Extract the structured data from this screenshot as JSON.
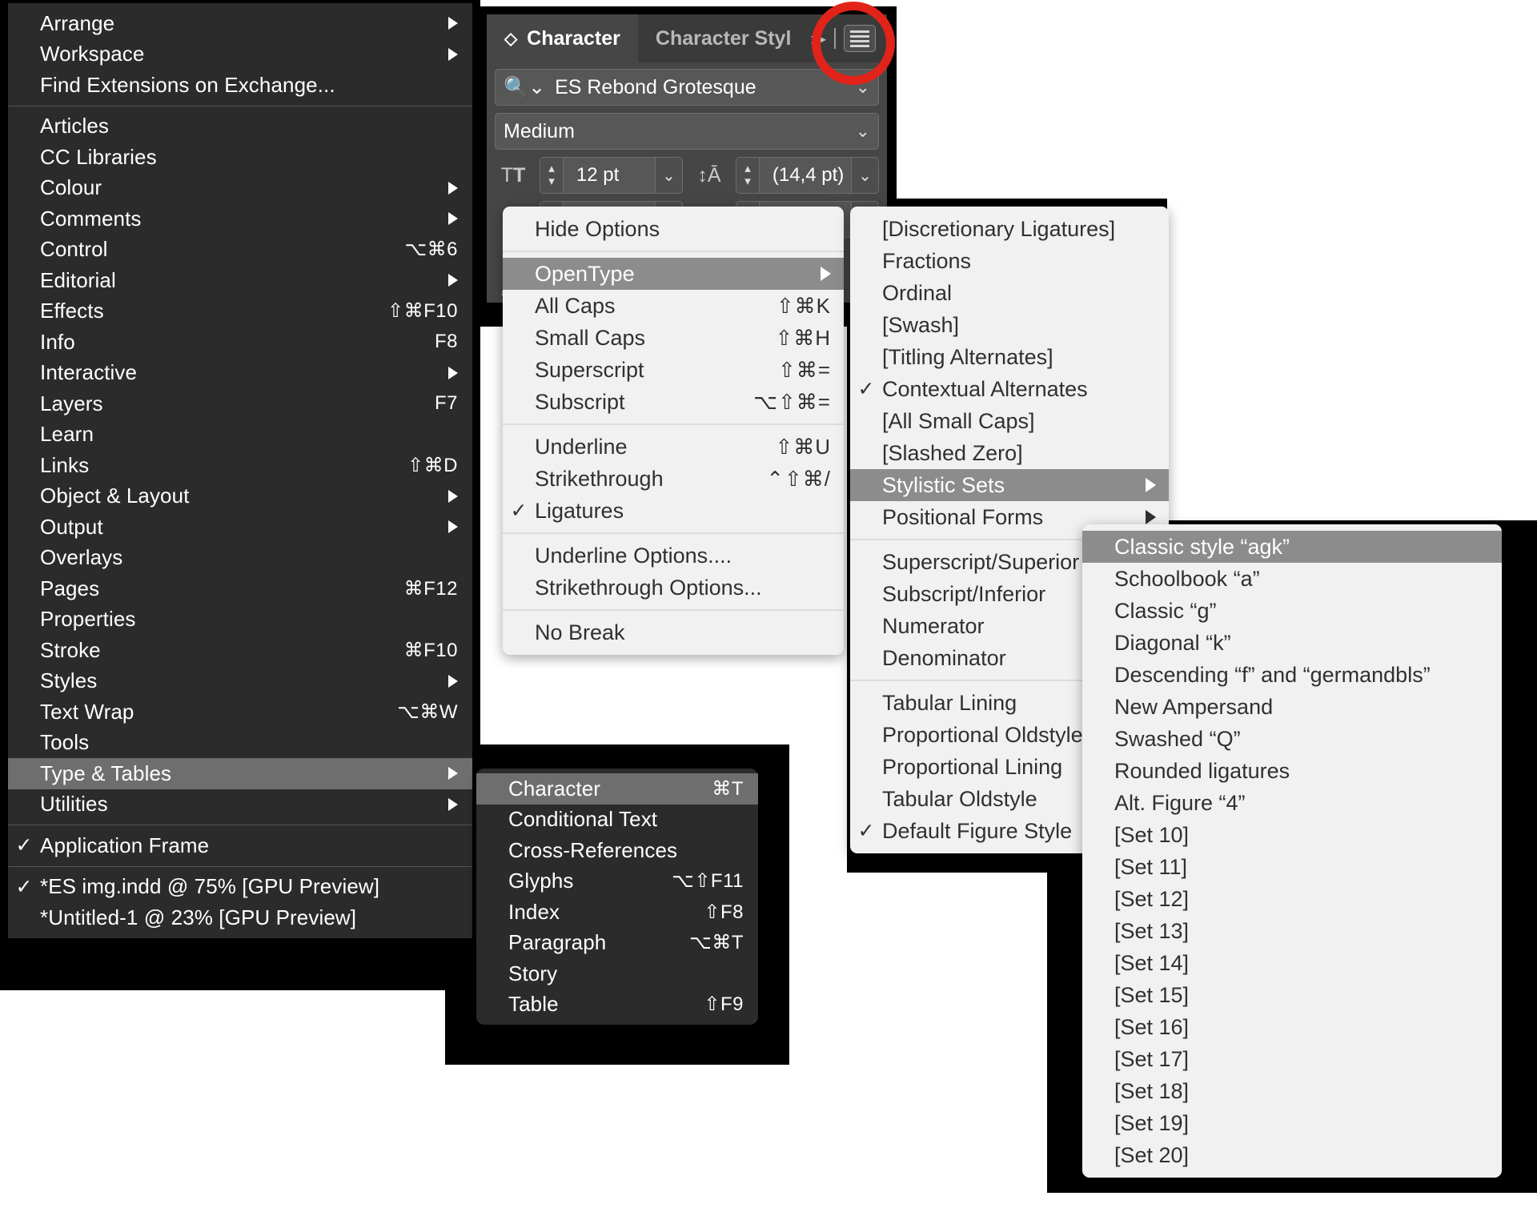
{
  "window_menu": {
    "name": "Window menu",
    "groups": [
      {
        "items": [
          {
            "label": "Arrange",
            "shortcut": "",
            "submenu": true,
            "checked": false
          },
          {
            "label": "Workspace",
            "shortcut": "",
            "submenu": true,
            "checked": false
          },
          {
            "label": "Find Extensions on Exchange...",
            "shortcut": "",
            "submenu": false,
            "checked": false
          }
        ]
      },
      {
        "items": [
          {
            "label": "Articles",
            "shortcut": "",
            "submenu": false,
            "checked": false
          },
          {
            "label": "CC Libraries",
            "shortcut": "",
            "submenu": false,
            "checked": false
          },
          {
            "label": "Colour",
            "shortcut": "",
            "submenu": true,
            "checked": false
          },
          {
            "label": "Comments",
            "shortcut": "",
            "submenu": true,
            "checked": false
          },
          {
            "label": "Control",
            "shortcut": "⌥⌘6",
            "submenu": false,
            "checked": false
          },
          {
            "label": "Editorial",
            "shortcut": "",
            "submenu": true,
            "checked": false
          },
          {
            "label": "Effects",
            "shortcut": "⇧⌘F10",
            "submenu": false,
            "checked": false
          },
          {
            "label": "Info",
            "shortcut": "F8",
            "submenu": false,
            "checked": false
          },
          {
            "label": "Interactive",
            "shortcut": "",
            "submenu": true,
            "checked": false
          },
          {
            "label": "Layers",
            "shortcut": "F7",
            "submenu": false,
            "checked": false
          },
          {
            "label": "Learn",
            "shortcut": "",
            "submenu": false,
            "checked": false
          },
          {
            "label": "Links",
            "shortcut": "⇧⌘D",
            "submenu": false,
            "checked": false
          },
          {
            "label": "Object & Layout",
            "shortcut": "",
            "submenu": true,
            "checked": false
          },
          {
            "label": "Output",
            "shortcut": "",
            "submenu": true,
            "checked": false
          },
          {
            "label": "Overlays",
            "shortcut": "",
            "submenu": false,
            "checked": false
          },
          {
            "label": "Pages",
            "shortcut": "⌘F12",
            "submenu": false,
            "checked": false
          },
          {
            "label": "Properties",
            "shortcut": "",
            "submenu": false,
            "checked": false
          },
          {
            "label": "Stroke",
            "shortcut": "⌘F10",
            "submenu": false,
            "checked": false
          },
          {
            "label": "Styles",
            "shortcut": "",
            "submenu": true,
            "checked": false
          },
          {
            "label": "Text Wrap",
            "shortcut": "⌥⌘W",
            "submenu": false,
            "checked": false
          },
          {
            "label": "Tools",
            "shortcut": "",
            "submenu": false,
            "checked": false
          },
          {
            "label": "Type & Tables",
            "shortcut": "",
            "submenu": true,
            "checked": false,
            "highlighted": true
          },
          {
            "label": "Utilities",
            "shortcut": "",
            "submenu": true,
            "checked": false
          }
        ]
      },
      {
        "items": [
          {
            "label": "Application Frame",
            "shortcut": "",
            "submenu": false,
            "checked": true
          }
        ]
      },
      {
        "items": [
          {
            "label": "*ES img.indd @ 75% [GPU Preview]",
            "shortcut": "",
            "submenu": false,
            "checked": true
          },
          {
            "label": "*Untitled-1 @ 23% [GPU Preview]",
            "shortcut": "",
            "submenu": false,
            "checked": false
          }
        ]
      }
    ]
  },
  "type_tables_submenu": {
    "name": "Type & Tables submenu",
    "items": [
      {
        "label": "Character",
        "shortcut": "⌘T",
        "highlighted": true
      },
      {
        "label": "Conditional Text",
        "shortcut": ""
      },
      {
        "label": "Cross-References",
        "shortcut": ""
      },
      {
        "label": "Glyphs",
        "shortcut": "⌥⇧F11"
      },
      {
        "label": "Index",
        "shortcut": "⇧F8"
      },
      {
        "label": "Paragraph",
        "shortcut": "⌥⌘T"
      },
      {
        "label": "Story",
        "shortcut": ""
      },
      {
        "label": "Table",
        "shortcut": "⇧F9"
      }
    ]
  },
  "character_panel": {
    "name": "Character panel",
    "tabs": [
      {
        "label": "Character",
        "active": true
      },
      {
        "label": "Character Styl",
        "active": false
      }
    ],
    "grip_icon": "grip-diamond-icon",
    "overflow_icon": "chevron-right-icon",
    "menu_icon": "panel-menu-hamburger-icon",
    "font_family": {
      "value": "ES Rebond Grotesque",
      "search_icon": "search-icon",
      "dropdown_icon": "chevron-down-icon"
    },
    "font_style": {
      "value": "Medium",
      "dropdown_icon": "chevron-down-icon"
    },
    "font_size": {
      "icon": "font-size-icon",
      "value": "12 pt",
      "dropdown_icon": "chevron-down-icon"
    },
    "leading": {
      "icon": "leading-icon",
      "value": "(14,4 pt)",
      "dropdown_icon": "chevron-down-icon"
    },
    "kerning_icon": "kerning-icon",
    "tracking_icon": "tracking-icon",
    "vertical_scale_icon": "vertical-scale-icon",
    "baseline_shift_icon": "baseline-shift-icon"
  },
  "highlight": {
    "name": "red-annotation-circle",
    "color": "#e2231a",
    "target": "panel-menu-hamburger-icon"
  },
  "panel_menu": {
    "name": "Character panel flyout menu",
    "groups": [
      {
        "items": [
          {
            "label": "Hide Options",
            "shortcut": "",
            "submenu": false,
            "checked": false
          }
        ]
      },
      {
        "items": [
          {
            "label": "OpenType",
            "shortcut": "",
            "submenu": true,
            "checked": false,
            "highlighted": true
          },
          {
            "label": "All Caps",
            "shortcut": "⇧⌘K",
            "submenu": false,
            "checked": false
          },
          {
            "label": "Small Caps",
            "shortcut": "⇧⌘H",
            "submenu": false,
            "checked": false
          },
          {
            "label": "Superscript",
            "shortcut": "⇧⌘=",
            "submenu": false,
            "checked": false
          },
          {
            "label": "Subscript",
            "shortcut": "⌥⇧⌘=",
            "submenu": false,
            "checked": false
          }
        ]
      },
      {
        "items": [
          {
            "label": "Underline",
            "shortcut": "⇧⌘U",
            "submenu": false,
            "checked": false
          },
          {
            "label": "Strikethrough",
            "shortcut": "⌃⇧⌘/",
            "submenu": false,
            "checked": false
          },
          {
            "label": "Ligatures",
            "shortcut": "",
            "submenu": false,
            "checked": true
          }
        ]
      },
      {
        "items": [
          {
            "label": "Underline Options....",
            "shortcut": "",
            "submenu": false,
            "checked": false
          },
          {
            "label": "Strikethrough Options...",
            "shortcut": "",
            "submenu": false,
            "checked": false
          }
        ]
      },
      {
        "items": [
          {
            "label": "No Break",
            "shortcut": "",
            "submenu": false,
            "checked": false
          }
        ]
      }
    ]
  },
  "opentype_submenu": {
    "name": "OpenType submenu",
    "groups": [
      {
        "items": [
          {
            "label": "[Discretionary Ligatures]",
            "submenu": false,
            "checked": false
          },
          {
            "label": "Fractions",
            "submenu": false,
            "checked": false
          },
          {
            "label": "Ordinal",
            "submenu": false,
            "checked": false
          },
          {
            "label": "[Swash]",
            "submenu": false,
            "checked": false
          },
          {
            "label": "[Titling Alternates]",
            "submenu": false,
            "checked": false
          },
          {
            "label": "Contextual Alternates",
            "submenu": false,
            "checked": true
          },
          {
            "label": "[All Small Caps]",
            "submenu": false,
            "checked": false
          },
          {
            "label": "[Slashed Zero]",
            "submenu": false,
            "checked": false
          },
          {
            "label": "Stylistic Sets",
            "submenu": true,
            "checked": false,
            "highlighted": true
          },
          {
            "label": "Positional Forms",
            "submenu": true,
            "checked": false
          }
        ]
      },
      {
        "items": [
          {
            "label": "Superscript/Superior",
            "submenu": false,
            "checked": false
          },
          {
            "label": "Subscript/Inferior",
            "submenu": false,
            "checked": false
          },
          {
            "label": "Numerator",
            "submenu": false,
            "checked": false
          },
          {
            "label": "Denominator",
            "submenu": false,
            "checked": false
          }
        ]
      },
      {
        "items": [
          {
            "label": "Tabular Lining",
            "submenu": false,
            "checked": false
          },
          {
            "label": "Proportional Oldstyle",
            "submenu": false,
            "checked": false
          },
          {
            "label": "Proportional Lining",
            "submenu": false,
            "checked": false
          },
          {
            "label": "Tabular Oldstyle",
            "submenu": false,
            "checked": false
          },
          {
            "label": "Default Figure Style",
            "submenu": false,
            "checked": true
          }
        ]
      }
    ]
  },
  "stylistic_sets_submenu": {
    "name": "Stylistic Sets submenu",
    "items": [
      {
        "label": "Classic style “agk”",
        "highlighted": true
      },
      {
        "label": "Schoolbook “a”"
      },
      {
        "label": "Classic “g”"
      },
      {
        "label": "Diagonal “k”"
      },
      {
        "label": "Descending “f” and “germandbls”"
      },
      {
        "label": "New Ampersand"
      },
      {
        "label": "Swashed “Q”"
      },
      {
        "label": "Rounded ligatures"
      },
      {
        "label": "Alt. Figure “4”"
      },
      {
        "label": "[Set 10]"
      },
      {
        "label": "[Set 11]"
      },
      {
        "label": "[Set 12]"
      },
      {
        "label": "[Set 13]"
      },
      {
        "label": "[Set 14]"
      },
      {
        "label": "[Set 15]"
      },
      {
        "label": "[Set 16]"
      },
      {
        "label": "[Set 17]"
      },
      {
        "label": "[Set 18]"
      },
      {
        "label": "[Set 19]"
      },
      {
        "label": "[Set 20]"
      }
    ]
  }
}
